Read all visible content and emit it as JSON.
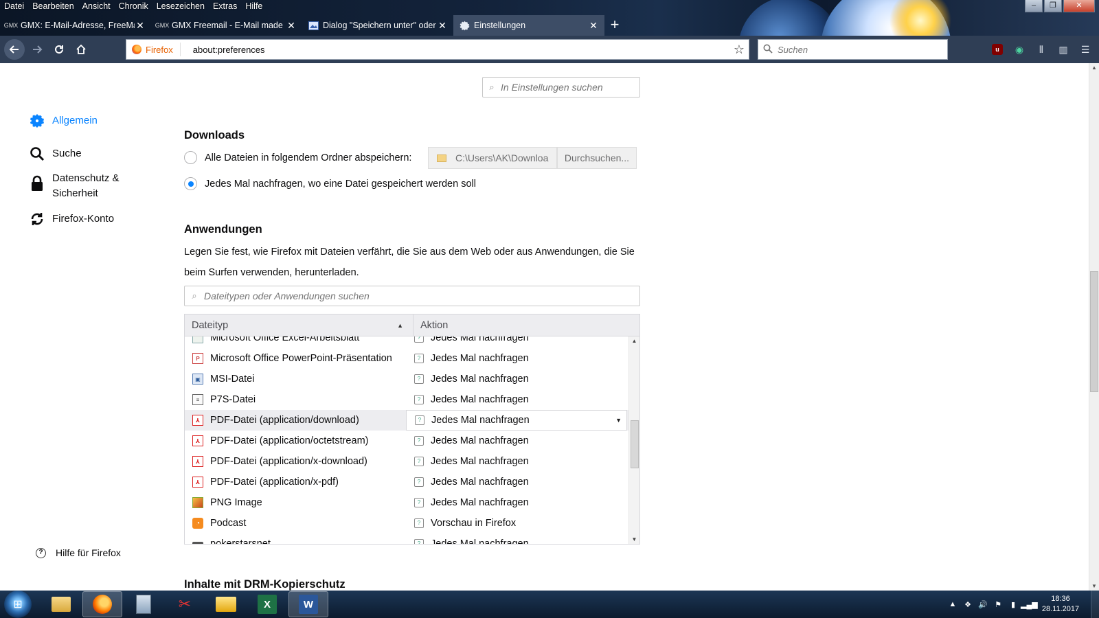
{
  "menubar": {
    "items": [
      "Datei",
      "Bearbeiten",
      "Ansicht",
      "Chronik",
      "Lesezeichen",
      "Extras",
      "Hilfe"
    ]
  },
  "tabs": [
    {
      "title": "GMX: E-Mail-Adresse, FreeMail",
      "icon": "gmx-icon",
      "active": false
    },
    {
      "title": "GMX Freemail - E-Mail made in",
      "icon": "gmx-icon",
      "active": false
    },
    {
      "title": "Dialog \"Speichern unter\" oder",
      "icon": "image-doc-icon",
      "active": false
    },
    {
      "title": "Einstellungen",
      "icon": "gear-icon",
      "active": true
    }
  ],
  "navbar": {
    "identity_label": "Firefox",
    "url": "about:preferences",
    "search_placeholder": "Suchen"
  },
  "prefs": {
    "search_placeholder": "In Einstellungen suchen",
    "nav": [
      {
        "label": "Allgemein",
        "icon": "gear-icon",
        "active": true
      },
      {
        "label": "Suche",
        "icon": "search-icon",
        "active": false
      },
      {
        "label": "Datenschutz & Sicherheit",
        "icon": "lock-icon",
        "active": false
      },
      {
        "label": "Firefox-Konto",
        "icon": "sync-icon",
        "active": false
      }
    ],
    "help_label": "Hilfe für Firefox",
    "downloads": {
      "title": "Downloads",
      "save_all_label": "Alle Dateien in folgendem Ordner abspeichern:",
      "folder_path": "C:\\Users\\AK\\Downloa",
      "browse_label": "Durchsuchen...",
      "ask_label": "Jedes Mal nachfragen, wo eine Datei gespeichert werden soll",
      "selected_option": "ask"
    },
    "applications": {
      "title": "Anwendungen",
      "description": "Legen Sie fest, wie Firefox mit Dateien verfährt, die Sie aus dem Web oder aus Anwendungen, die Sie beim Surfen verwenden, herunterladen.",
      "search_placeholder": "Dateitypen oder Anwendungen suchen",
      "col_type": "Dateityp",
      "col_action": "Aktion",
      "rows": [
        {
          "type": "Microsoft Office Excel-Arbeitsblatt",
          "icon": "excel-file-icon",
          "action": "Jedes Mal nachfragen"
        },
        {
          "type": "Microsoft Office PowerPoint-Präsentation",
          "icon": "powerpoint-file-icon",
          "action": "Jedes Mal nachfragen"
        },
        {
          "type": "MSI-Datei",
          "icon": "msi-file-icon",
          "action": "Jedes Mal nachfragen"
        },
        {
          "type": "P7S-Datei",
          "icon": "p7s-file-icon",
          "action": "Jedes Mal nachfragen"
        },
        {
          "type": "PDF-Datei (application/download)",
          "icon": "pdf-file-icon",
          "action": "Jedes Mal nachfragen",
          "selected": true
        },
        {
          "type": "PDF-Datei (application/octetstream)",
          "icon": "pdf-file-icon",
          "action": "Jedes Mal nachfragen"
        },
        {
          "type": "PDF-Datei (application/x-download)",
          "icon": "pdf-file-icon",
          "action": "Jedes Mal nachfragen"
        },
        {
          "type": "PDF-Datei (application/x-pdf)",
          "icon": "pdf-file-icon",
          "action": "Jedes Mal nachfragen"
        },
        {
          "type": "PNG Image",
          "icon": "png-file-icon",
          "action": "Jedes Mal nachfragen"
        },
        {
          "type": "Podcast",
          "icon": "rss-icon",
          "action": "Vorschau in Firefox"
        },
        {
          "type": "pokerstarsnet",
          "icon": "generic-file-icon",
          "action": "Jedes Mal nachfragen"
        }
      ]
    },
    "drm": {
      "title": "Inhalte mit DRM-Kopierschutz"
    }
  },
  "taskbar": {
    "clock_time": "18:36",
    "clock_date": "28.11.2017"
  }
}
